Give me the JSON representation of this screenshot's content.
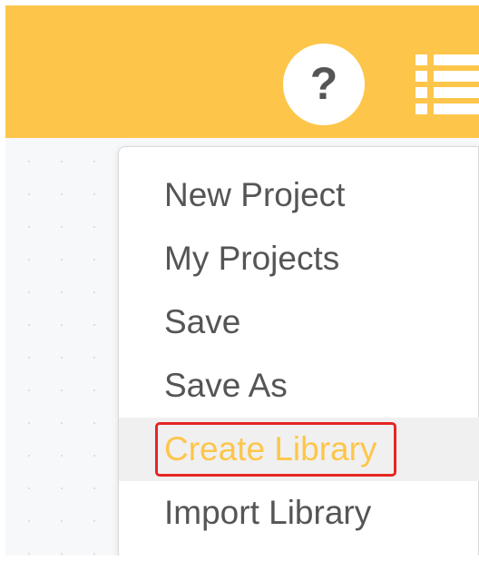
{
  "header": {
    "help_icon": "question-mark-icon",
    "help_glyph": "?",
    "menu_icon": "list-menu-icon",
    "background_color": "#fdc64a"
  },
  "menu": {
    "items": [
      {
        "label": "New Project",
        "active": false
      },
      {
        "label": "My Projects",
        "active": false
      },
      {
        "label": "Save",
        "active": false
      },
      {
        "label": "Save As",
        "active": false
      },
      {
        "label": "Create Library",
        "active": true
      },
      {
        "label": "Import Library",
        "active": false
      }
    ],
    "active_text_color": "#fdc64a",
    "highlight_color": "#e52622"
  }
}
